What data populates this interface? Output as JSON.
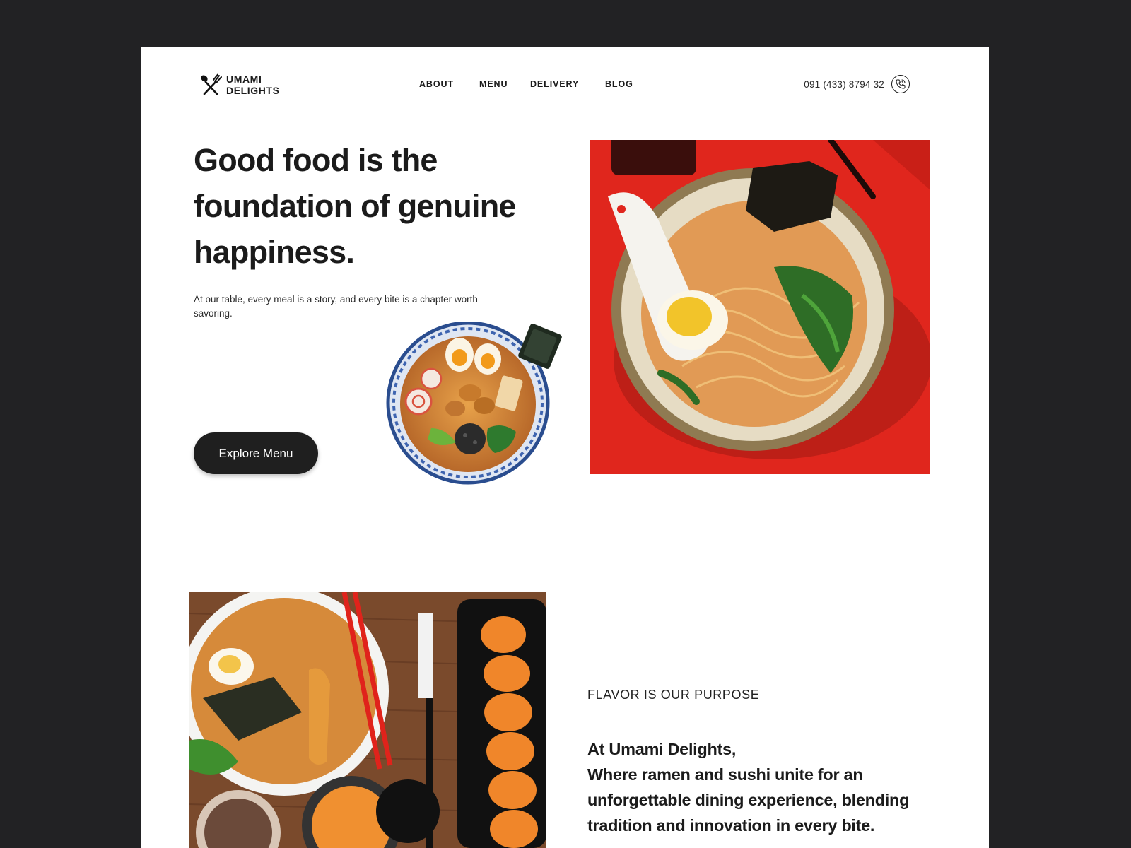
{
  "brand": {
    "line1": "UMAMI",
    "line2": "DELIGHTS",
    "logo_icon": "fork-spoon-icon"
  },
  "nav": {
    "items": [
      {
        "label": "ABOUT"
      },
      {
        "label": "MENU"
      },
      {
        "label": "DELIVERY"
      },
      {
        "label": "BLOG"
      }
    ]
  },
  "contact": {
    "phone": "091 (433) 8794 32",
    "icon": "phone-icon"
  },
  "hero": {
    "title": "Good food is the foundation of genuine happiness.",
    "subtitle": "At our table, every meal is a story, and every bite is a chapter worth savoring.",
    "cta_label": "Explore Menu"
  },
  "about": {
    "eyebrow": "FLAVOR IS OUR PURPOSE",
    "line1": "At Umami Delights,",
    "line2": "Where ramen and sushi unite for an unforgettable dining experience, blending tradition and innovation in every bite."
  },
  "colors": {
    "background": "#222224",
    "page": "#ffffff",
    "text": "#1b1b1b",
    "button": "#1f1f1f",
    "hero_image_bg": "#e0261d"
  }
}
